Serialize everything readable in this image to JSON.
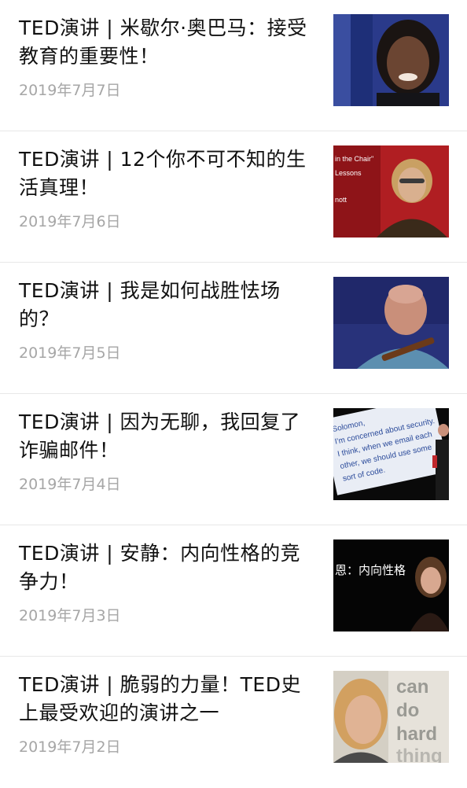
{
  "articles": [
    {
      "title": "TED演讲 | 米歇尔·奥巴马：接受教育的重要性！",
      "date": "2019年7月7日",
      "thumbnail": "michelle-obama-portrait-photo"
    },
    {
      "title": "TED演讲 | 12个你不可不知的生活真理！",
      "date": "2019年7月6日",
      "thumbnail": "speaker-with-glasses-photo",
      "thumb_text": [
        "in the Chair\"",
        "Lessons",
        "nott"
      ]
    },
    {
      "title": "TED演讲 | 我是如何战胜怯场的？",
      "date": "2019年7月5日",
      "thumbnail": "bald-speaker-with-guitar-photo"
    },
    {
      "title": "TED演讲 | 因为无聊，我回复了诈骗邮件！",
      "date": "2019年7月4日",
      "thumbnail": "slide-with-speaker-photo",
      "thumb_text": [
        "Solomon,",
        "I'm concerned about security.",
        "I think, when we email each",
        "other, we should use some",
        "sort of code."
      ]
    },
    {
      "title": "TED演讲 | 安静：内向性格的竞争力！",
      "date": "2019年7月3日",
      "thumbnail": "woman-speaker-on-stage-photo",
      "thumb_text": [
        "恩：内向性格"
      ]
    },
    {
      "title": "TED演讲 | 脆弱的力量！TED史上最受欢迎的演讲之一",
      "date": "2019年7月2日",
      "thumbnail": "smiling-woman-speaker-photo",
      "thumb_text": [
        "can",
        "do",
        "hard",
        "thing"
      ]
    }
  ],
  "colors": {
    "title": "#111111",
    "date": "#a6a6a6",
    "divider": "#e8e8e8"
  }
}
